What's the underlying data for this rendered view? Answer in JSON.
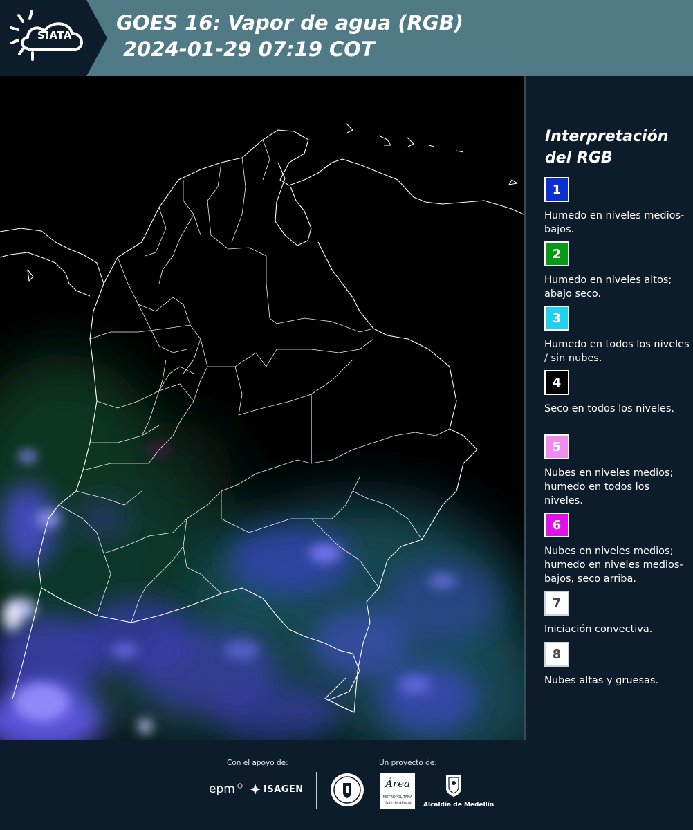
{
  "header": {
    "logo_text": "SIATA",
    "title_line1": "GOES 16: Vapor de agua (RGB)",
    "title_line2": "2024-01-29 07:19 COT"
  },
  "legend": {
    "title": "Interpretación del RGB",
    "items": [
      {
        "num": "1",
        "color": "#0a2fd0",
        "desc": "Humedo en niveles medios-bajos."
      },
      {
        "num": "2",
        "color": "#069a14",
        "desc": "Humedo en niveles altos; abajo seco."
      },
      {
        "num": "3",
        "color": "#20d0f0",
        "desc": "Humedo en todos los niveles / sin nubes."
      },
      {
        "num": "4",
        "color": "#000000",
        "desc": "Seco en todos los niveles."
      },
      {
        "num": "5",
        "color": "#f08cec",
        "desc": "Nubes en niveles medios; humedo en todos los niveles."
      },
      {
        "num": "6",
        "color": "#e010e8",
        "desc": "Nubes en niveles medios; humedo en niveles medios-bajos, seco arriba."
      },
      {
        "num": "7",
        "color": "#ffffff",
        "desc": "Iniciación convectiva."
      },
      {
        "num": "8",
        "color": "#ffffff",
        "desc": "Nubes altas y gruesas."
      }
    ]
  },
  "footer": {
    "support_label": "Con el apoyo de:",
    "project_label": "Un proyecto de:",
    "sponsor_epm": "epm",
    "sponsor_isagen": "ISAGEN",
    "partner_area_line1": "Área",
    "partner_area_line2": "METROPOLITANA",
    "partner_area_line3": "Valle de Aburrá",
    "partner_medellin": "Alcaldía de Medellín"
  },
  "colors": {
    "header_bg": "#4f7a86",
    "page_bg": "#0c1c2a",
    "map_bg": "#000000",
    "cloud_tint": "#6a6aff"
  }
}
